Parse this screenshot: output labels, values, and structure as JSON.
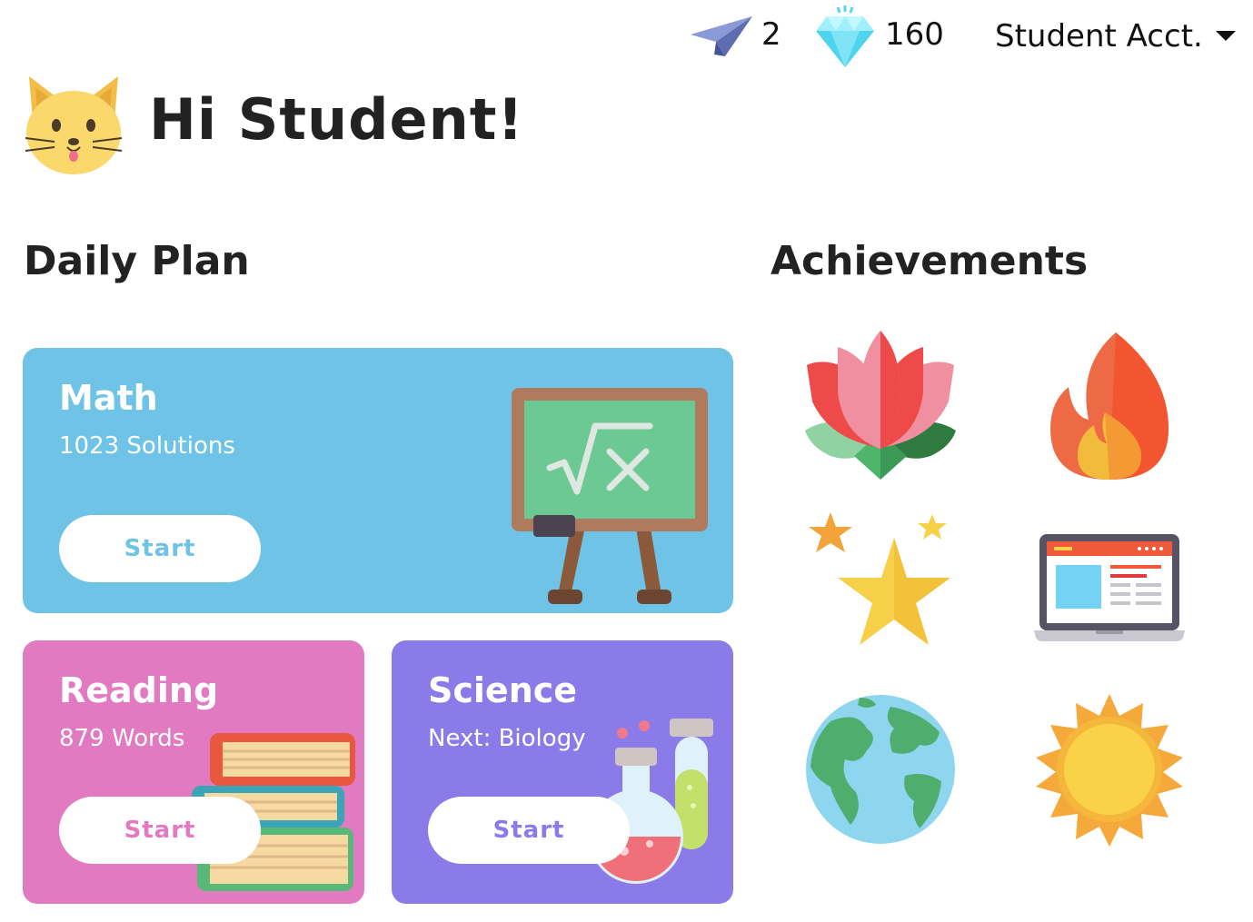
{
  "header": {
    "paper_plane_icon": "paper-plane-icon",
    "plane_count": "2",
    "gem_icon": "diamond-icon",
    "gem_count": "160",
    "account_label": "Student Acct."
  },
  "greeting": "Hi Student!",
  "daily_plan": {
    "title": "Daily Plan",
    "cards": [
      {
        "title": "Math",
        "subtitle": "1023 Solutions",
        "button": "Start",
        "color": "#6fc3e6",
        "illustration": "chalkboard-icon"
      },
      {
        "title": "Reading",
        "subtitle": "879 Words",
        "button": "Start",
        "color": "#e27ac1",
        "illustration": "books-icon"
      },
      {
        "title": "Science",
        "subtitle": "Next: Biology",
        "button": "Start",
        "color": "#8a7be8",
        "illustration": "flasks-icon"
      }
    ]
  },
  "achievements": {
    "title": "Achievements",
    "icons": [
      "lotus-icon",
      "fire-icon",
      "stars-icon",
      "laptop-icon",
      "earth-icon",
      "sun-icon"
    ]
  }
}
